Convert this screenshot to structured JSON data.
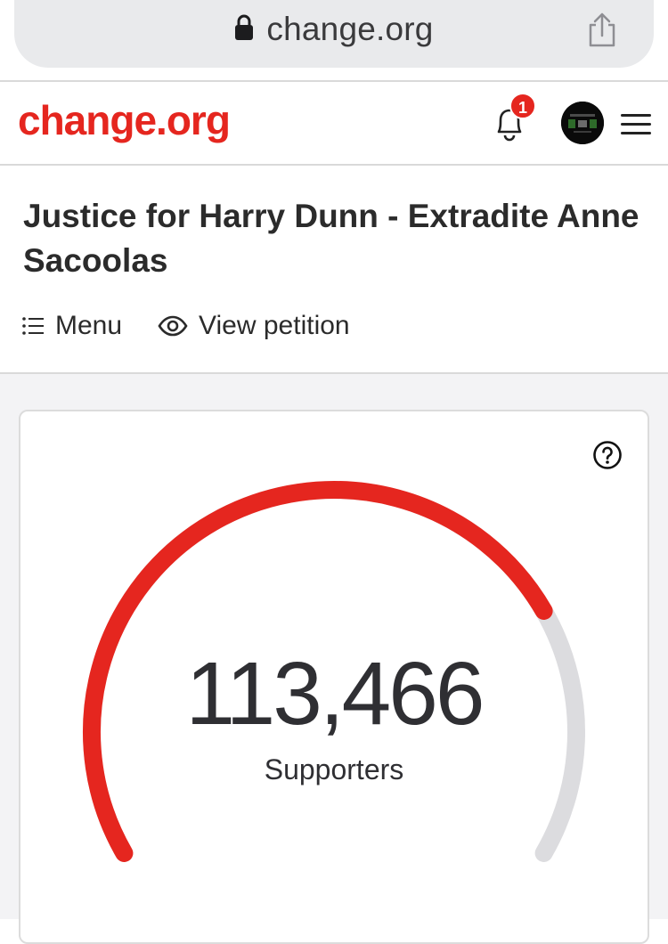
{
  "browser": {
    "url": "change.org",
    "icons": [
      "lock-icon",
      "share-icon"
    ]
  },
  "header": {
    "logo": "change.org",
    "notification_count": "1",
    "icons": [
      "bell-icon",
      "avatar",
      "hamburger-menu-icon"
    ]
  },
  "petition": {
    "title": "Justice for Harry Dunn - Extradite Anne Sacoolas",
    "menu_label": "Menu",
    "view_label": "View petition"
  },
  "stats": {
    "count": "113,466",
    "label": "Supporters",
    "progress": 0.75,
    "colors": {
      "accent": "#e5261f",
      "track": "#dcdcdf"
    }
  }
}
